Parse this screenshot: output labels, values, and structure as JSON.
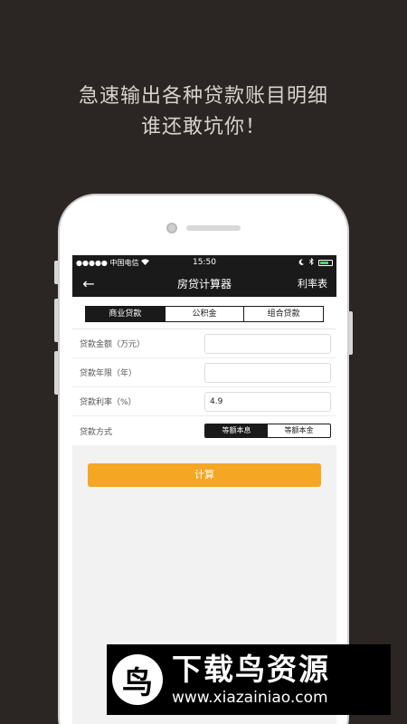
{
  "promo": {
    "line1": "急速输出各种贷款账目明细",
    "line2": "谁还敢坑你！"
  },
  "status": {
    "carrier": "●●●●● 中国电信",
    "wifi_icon": "wifi-icon",
    "time": "15:50",
    "icons": [
      "moon-icon",
      "bluetooth-icon",
      "battery-icon"
    ]
  },
  "nav": {
    "back_icon": "arrow-left-icon",
    "back_glyph": "←",
    "title": "房贷计算器",
    "rate_table": "利率表"
  },
  "tabs": [
    {
      "label": "商业贷款",
      "selected": true
    },
    {
      "label": "公积金",
      "selected": false
    },
    {
      "label": "组合贷款",
      "selected": false
    }
  ],
  "form": {
    "amount_label": "贷款金额（万元）",
    "amount_value": "",
    "term_label": "贷款年限（年）",
    "term_value": "",
    "rate_label": "贷款利率（%）",
    "rate_value": "4.9",
    "method_label": "贷款方式",
    "method_options": [
      {
        "label": "等额本息",
        "selected": true
      },
      {
        "label": "等额本金",
        "selected": false
      }
    ]
  },
  "calc_button": "计算",
  "watermark": {
    "logo_glyph": "鸟",
    "title": "下载鸟资源",
    "url": "www.xiazainiao.com"
  },
  "colors": {
    "background": "#2b2624",
    "bar": "#1a1a1a",
    "accent": "#f5a623"
  }
}
